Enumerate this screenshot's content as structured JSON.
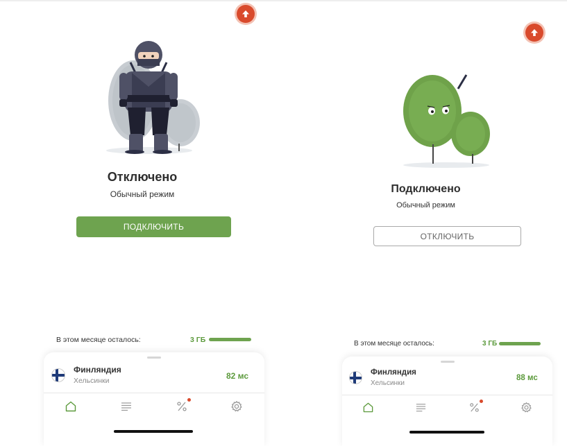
{
  "screens": [
    {
      "status_title": "Отключено",
      "status_subtitle": "Обычный режим",
      "action_button_label": "ПОДКЛЮЧИТЬ",
      "quota_label": "В этом месяце осталось:",
      "quota_amount": "3 ГБ",
      "quota_remaining_fraction": 1.0,
      "server": {
        "country": "Финляндия",
        "city": "Хельсинки",
        "ping": "82 мс"
      },
      "nav": [
        "home-icon",
        "list-icon",
        "percent-icon",
        "gear-icon"
      ]
    },
    {
      "status_title": "Подключено",
      "status_subtitle": "Обычный режим",
      "action_button_label": "ОТКЛЮЧИТЬ",
      "quota_label": "В этом месяце осталось:",
      "quota_amount": "3 ГБ",
      "quota_remaining_fraction": 1.0,
      "server": {
        "country": "Финляндия",
        "city": "Хельсинки",
        "ping": "88 мс"
      },
      "nav": [
        "home-icon",
        "list-icon",
        "percent-icon",
        "gear-icon"
      ]
    }
  ],
  "colors": {
    "accent_green": "#6ea34f",
    "upgrade_red": "#d94a2c",
    "notification_dot": "#d94a2c"
  }
}
